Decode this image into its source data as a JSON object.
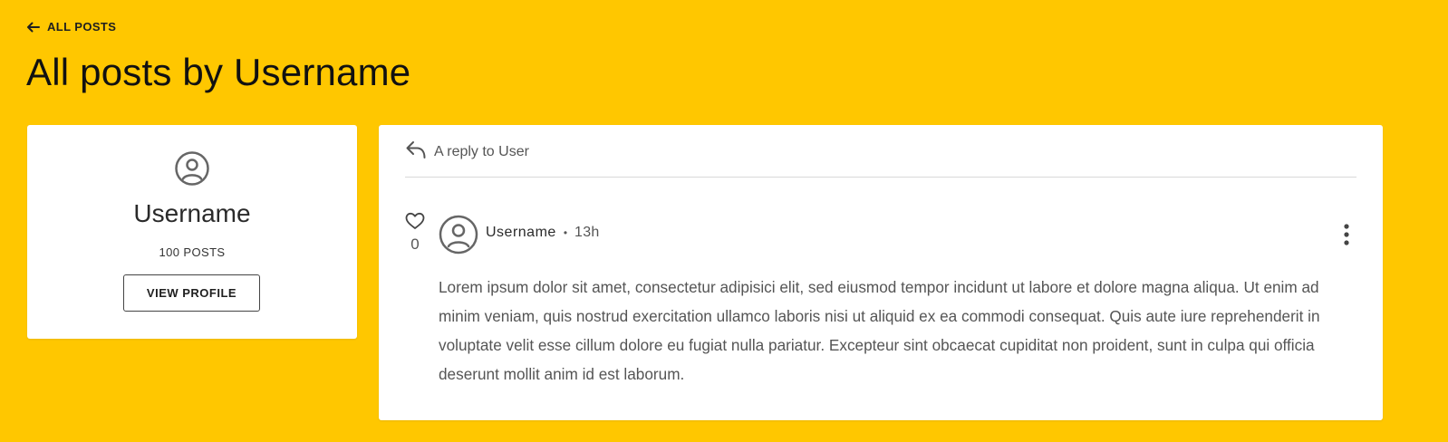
{
  "nav": {
    "back_label": "ALL POSTS",
    "back_icon": "arrow-left-icon"
  },
  "page": {
    "title": "All posts by Username"
  },
  "profile": {
    "avatar_icon": "user-circle-icon",
    "name": "Username",
    "posts_count": "100 POSTS",
    "view_button": "VIEW PROFILE"
  },
  "post": {
    "reply_icon": "reply-icon",
    "reply_to": "A reply to User",
    "like_icon": "heart-outline-icon",
    "likes": "0",
    "author_avatar_icon": "user-circle-icon",
    "author": "Username",
    "separator": "•",
    "time": "13h",
    "menu_icon": "more-vertical-icon",
    "body": "Lorem ipsum dolor sit amet, consectetur adipisici elit, sed eiusmod tempor incidunt ut labore et dolore magna aliqua. Ut enim ad minim veniam, quis nostrud exercitation ullamco laboris nisi ut aliquid ex ea commodi consequat. Quis aute iure reprehenderit in voluptate velit esse cillum dolore eu fugiat nulla pariatur. Excepteur sint obcaecat cupiditat non proident, sunt in culpa qui officia deserunt mollit anim id est laborum."
  },
  "colors": {
    "background": "#ffc700",
    "card": "#ffffff",
    "text_dark": "#1f1f1f",
    "text_muted": "#555555",
    "divider": "#d9d9d9"
  }
}
